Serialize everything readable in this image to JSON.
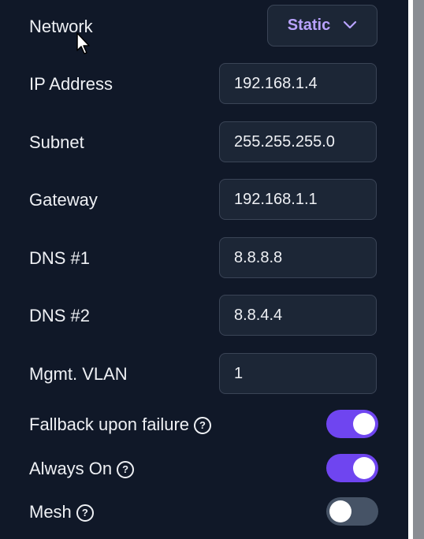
{
  "network": {
    "label": "Network",
    "mode": "Static"
  },
  "fields": {
    "ip_label": "IP Address",
    "ip_value": "192.168.1.4",
    "subnet_label": "Subnet",
    "subnet_value": "255.255.255.0",
    "gateway_label": "Gateway",
    "gateway_value": "192.168.1.1",
    "dns1_label": "DNS #1",
    "dns1_value": "8.8.8.8",
    "dns2_label": "DNS #2",
    "dns2_value": "8.8.4.4",
    "vlan_label": "Mgmt. VLAN",
    "vlan_value": "1"
  },
  "toggles": {
    "fallback_label": "Fallback upon failure",
    "fallback_on": true,
    "always_on_label": "Always On",
    "always_on_on": true,
    "mesh_label": "Mesh",
    "mesh_on": false
  },
  "icons": {
    "help": "help-circle-icon",
    "chevron": "chevron-down-icon",
    "cursor": "mouse-pointer-icon"
  },
  "colors": {
    "accent": "#6f45f0",
    "select_text": "#b9a3ff",
    "background": "#101828"
  }
}
